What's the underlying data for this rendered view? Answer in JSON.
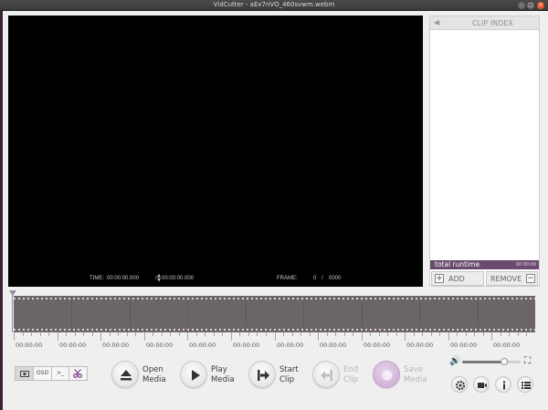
{
  "window": {
    "title": "VidCutter - aEx7nVO_460svwm.webm",
    "minimize_glyph": "–",
    "maximize_glyph": "□",
    "close_glyph": "×"
  },
  "video": {
    "time_label": "TIME:",
    "time_current": "00:00:00.000",
    "time_separator": "/",
    "time_total": "00:00:00.000",
    "frame_label": "FRAME:",
    "frame_current": "0",
    "frame_separator": "/",
    "frame_total": "0000"
  },
  "clip_index": {
    "title": "CLIP INDEX",
    "collapse_icon": "triangle-left-icon",
    "runtime_label": "total runtime",
    "runtime_value": "00:00:00",
    "add_label": "ADD",
    "add_glyph": "+",
    "remove_label": "REMOVE",
    "remove_glyph": "−"
  },
  "timeline": {
    "labels": [
      "00:00:00",
      "00:00:00",
      "00:00:00",
      "00:00:00",
      "00:00:00",
      "00:00:00",
      "00:00:00",
      "00:00:00",
      "00:00:00",
      "00:00:00",
      "00:00:00",
      "00:00:00"
    ],
    "seek_position": 0
  },
  "modes": {
    "osd_label": "OSD",
    "console_label": ">_"
  },
  "controls": {
    "open": {
      "line1": "Open",
      "line2": "Media"
    },
    "play": {
      "line1": "Play",
      "line2": "Media"
    },
    "start": {
      "line1": "Start",
      "line2": "Clip"
    },
    "end": {
      "line1": "End",
      "line2": "Clip"
    },
    "save": {
      "line1": "Save",
      "line2": "Media"
    }
  },
  "volume": {
    "level": 0.72
  },
  "colors": {
    "accent": "#6a4a6e",
    "filmstrip": "#6b6568",
    "save_disabled": "#c9a8d3",
    "scissors": "#7b3f8a"
  }
}
